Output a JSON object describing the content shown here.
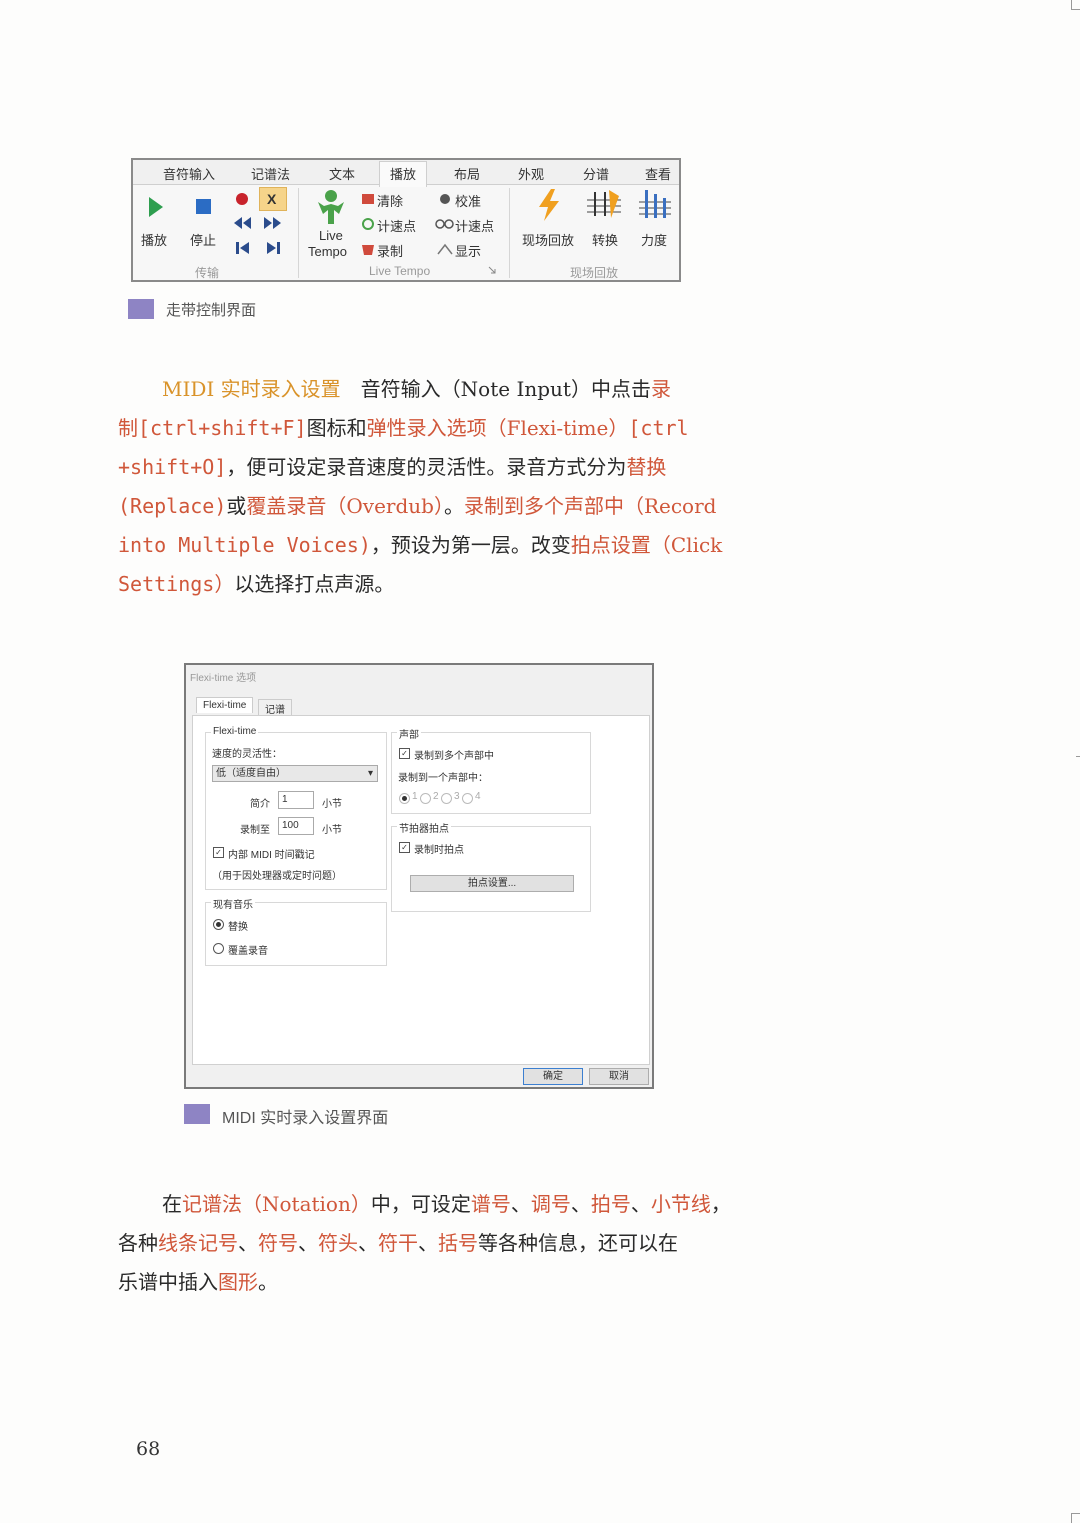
{
  "ribbon": {
    "tabs": [
      "音符输入",
      "记谱法",
      "文本",
      "播放",
      "布局",
      "外观",
      "分谱",
      "查看"
    ],
    "active_tab": "播放",
    "buttons": {
      "play": "播放",
      "stop": "停止",
      "live_tempo_line1": "Live",
      "live_tempo_line2": "Tempo",
      "clear": "清除",
      "tap_tempo": "计速点",
      "record": "录制",
      "calibrate": "校准",
      "tap_tempo2": "计速点",
      "display": "显示",
      "live_playback": "现场回放",
      "transform": "转换",
      "velocity": "力度"
    },
    "groups": {
      "transport": "传输",
      "live_tempo": "Live Tempo",
      "live_playback": "现场回放"
    }
  },
  "caption1": "走带控制界面",
  "paragraph1": {
    "lines": [
      [
        {
          "t": "MIDI 实时录入设置",
          "c": "y"
        },
        {
          "t": "　音符输入（Note Input）中点击",
          "c": ""
        },
        {
          "t": "录",
          "c": "o"
        }
      ],
      [
        {
          "t": "制",
          "c": "o"
        },
        {
          "t": "[ctrl+shift+F]",
          "c": "o"
        },
        {
          "t": "图标和",
          "c": ""
        },
        {
          "t": "弹性录入选项（Flexi-time）",
          "c": "o"
        },
        {
          "t": "[ctrl",
          "c": "o"
        }
      ],
      [
        {
          "t": "+shift+O]",
          "c": "o"
        },
        {
          "t": "，便可设定录音速度的灵活性。录音方式分为",
          "c": ""
        },
        {
          "t": "替换",
          "c": "o"
        }
      ],
      [
        {
          "t": "(Replace)",
          "c": "o"
        },
        {
          "t": "或",
          "c": ""
        },
        {
          "t": "覆盖录音（Overdub）",
          "c": "o"
        },
        {
          "t": "。",
          "c": ""
        },
        {
          "t": "录制到多个声部中（Record",
          "c": "o"
        }
      ],
      [
        {
          "t": "into Multiple Voices)",
          "c": "o"
        },
        {
          "t": "，预设为第一层。改变",
          "c": ""
        },
        {
          "t": "拍点设置（Click",
          "c": "o"
        }
      ],
      [
        {
          "t": "Settings）",
          "c": "o"
        },
        {
          "t": "以选择打点声源。",
          "c": ""
        }
      ]
    ]
  },
  "dialog": {
    "title": "Flexi-time 选项",
    "tabs": [
      "Flexi-time",
      "记谱"
    ],
    "flexi_group": "Flexi-time",
    "flex_label": "速度的灵活性：",
    "flex_value": "低（适度自由）",
    "intro_label": "简介",
    "intro_value": "1",
    "intro_unit": "小节",
    "record_to_label": "录制至",
    "record_to_value": "100",
    "record_to_unit": "小节",
    "midi_timestamp": "内部 MIDI 时间戳记",
    "midi_note": "（用于因处理器或定时问题）",
    "existing_music_group": "现有音乐",
    "replace": "替换",
    "overdub": "覆盖录音",
    "voices_group": "声部",
    "record_multi": "录制到多个声部中",
    "record_one": "录制到一个声部中：",
    "voice_options": [
      "1",
      "2",
      "3",
      "4"
    ],
    "metronome_group": "节拍器拍点",
    "record_click": "录制时拍点",
    "click_settings": "拍点设置...",
    "ok": "确定",
    "cancel": "取消"
  },
  "caption2": "MIDI 实时录入设置界面",
  "paragraph2": {
    "lines": [
      [
        {
          "t": "在",
          "c": ""
        },
        {
          "t": "记谱法（Notation）",
          "c": "o"
        },
        {
          "t": "中，可设定",
          "c": ""
        },
        {
          "t": "谱号",
          "c": "o"
        },
        {
          "t": "、",
          "c": ""
        },
        {
          "t": "调号",
          "c": "o"
        },
        {
          "t": "、",
          "c": ""
        },
        {
          "t": "拍号",
          "c": "o"
        },
        {
          "t": "、",
          "c": ""
        },
        {
          "t": "小节线",
          "c": "o"
        },
        {
          "t": "，",
          "c": ""
        }
      ],
      [
        {
          "t": "各种",
          "c": ""
        },
        {
          "t": "线条记号",
          "c": "o"
        },
        {
          "t": "、",
          "c": ""
        },
        {
          "t": "符号",
          "c": "o"
        },
        {
          "t": "、",
          "c": ""
        },
        {
          "t": "符头",
          "c": "o"
        },
        {
          "t": "、",
          "c": ""
        },
        {
          "t": "符干",
          "c": "o"
        },
        {
          "t": "、",
          "c": ""
        },
        {
          "t": "括号",
          "c": "o"
        },
        {
          "t": "等各种信息，还可以在",
          "c": ""
        }
      ],
      [
        {
          "t": "乐谱中插入",
          "c": ""
        },
        {
          "t": "图形",
          "c": "o"
        },
        {
          "t": "。",
          "c": ""
        }
      ]
    ]
  },
  "page_number": "68",
  "colors": {
    "highlight_yellow": "#d9932a",
    "highlight_orange": "#d0573a",
    "caption_square": "#8e84c4"
  }
}
